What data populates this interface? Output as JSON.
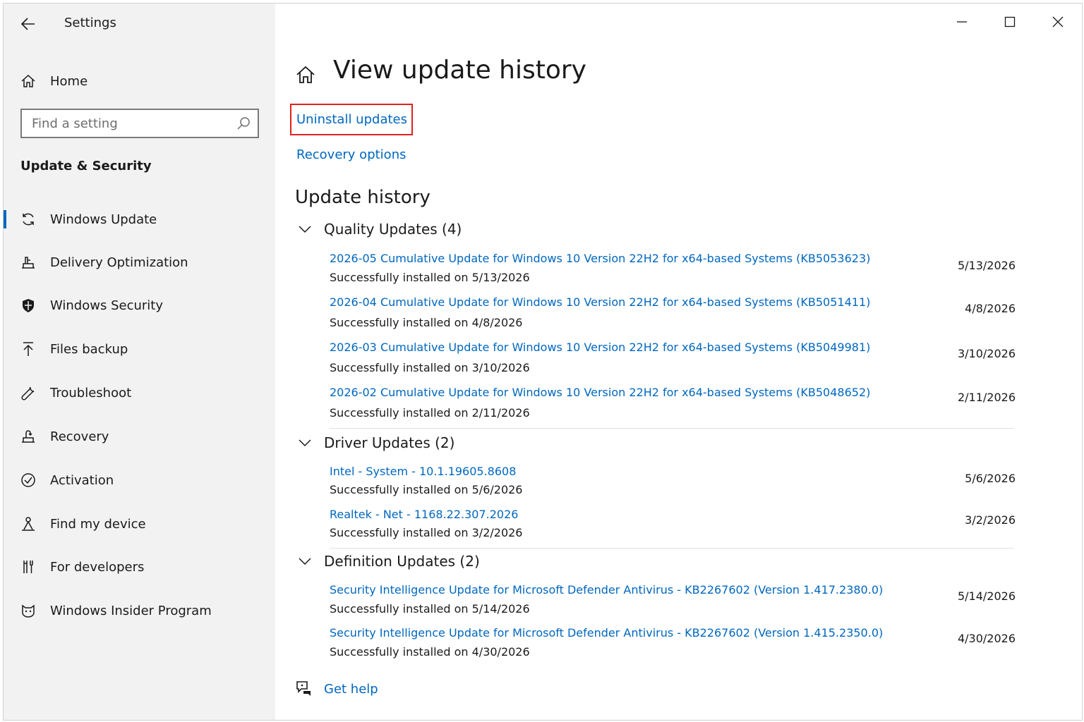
{
  "app": {
    "title": "Settings"
  },
  "sidebar": {
    "home_label": "Home",
    "search_placeholder": "Find a setting",
    "section_title": "Update & Security",
    "items": [
      {
        "label": "Windows Update",
        "icon": "refresh-icon",
        "selected": true
      },
      {
        "label": "Delivery Optimization",
        "icon": "delivery-optimization-icon",
        "selected": false
      },
      {
        "label": "Windows Security",
        "icon": "shield-icon",
        "selected": false
      },
      {
        "label": "Files backup",
        "icon": "upload-arrow-icon",
        "selected": false
      },
      {
        "label": "Troubleshoot",
        "icon": "wrench-icon",
        "selected": false
      },
      {
        "label": "Recovery",
        "icon": "recovery-icon",
        "selected": false
      },
      {
        "label": "Activation",
        "icon": "check-circle-icon",
        "selected": false
      },
      {
        "label": "Find my device",
        "icon": "person-location-icon",
        "selected": false
      },
      {
        "label": "For developers",
        "icon": "developer-tools-icon",
        "selected": false
      },
      {
        "label": "Windows Insider Program",
        "icon": "insider-cat-icon",
        "selected": false
      }
    ]
  },
  "main": {
    "title": "View update history",
    "uninstall_link": "Uninstall updates",
    "recovery_link": "Recovery options",
    "history_heading": "Update history",
    "groups": [
      {
        "label": "Quality Updates (4)",
        "updates": [
          {
            "name": "2026-05 Cumulative Update for Windows 10 Version 22H2 for x64-based Systems (KB5053623)",
            "status": "Successfully installed on 5/13/2026",
            "date": "5/13/2026"
          },
          {
            "name": "2026-04 Cumulative Update for Windows 10 Version 22H2 for x64-based Systems (KB5051411)",
            "status": "Successfully installed on 4/8/2026",
            "date": "4/8/2026"
          },
          {
            "name": "2026-03 Cumulative Update for Windows 10 Version 22H2 for x64-based Systems (KB5049981)",
            "status": "Successfully installed on 3/10/2026",
            "date": "3/10/2026"
          },
          {
            "name": "2026-02 Cumulative Update for Windows 10 Version 22H2 for x64-based Systems (KB5048652)",
            "status": "Successfully installed on 2/11/2026",
            "date": "2/11/2026"
          }
        ]
      },
      {
        "label": "Driver Updates (2)",
        "updates": [
          {
            "name": "Intel - System - 10.1.19605.8608",
            "status": "Successfully installed on 5/6/2026",
            "date": "5/6/2026"
          },
          {
            "name": "Realtek - Net - 1168.22.307.2026",
            "status": "Successfully installed on 3/2/2026",
            "date": "3/2/2026"
          }
        ]
      },
      {
        "label": "Definition Updates (2)",
        "updates": [
          {
            "name": "Security Intelligence Update for Microsoft Defender Antivirus - KB2267602 (Version 1.417.2380.0)",
            "status": "Successfully installed on 5/14/2026",
            "date": "5/14/2026"
          },
          {
            "name": "Security Intelligence Update for Microsoft Defender Antivirus - KB2267602 (Version 1.415.2350.0)",
            "status": "Successfully installed on 4/30/2026",
            "date": "4/30/2026"
          }
        ]
      }
    ],
    "help_link": "Get help"
  },
  "colors": {
    "accent": "#0067c0",
    "sidebar_bg": "#f2f2f2",
    "highlight_border": "#e02020"
  }
}
